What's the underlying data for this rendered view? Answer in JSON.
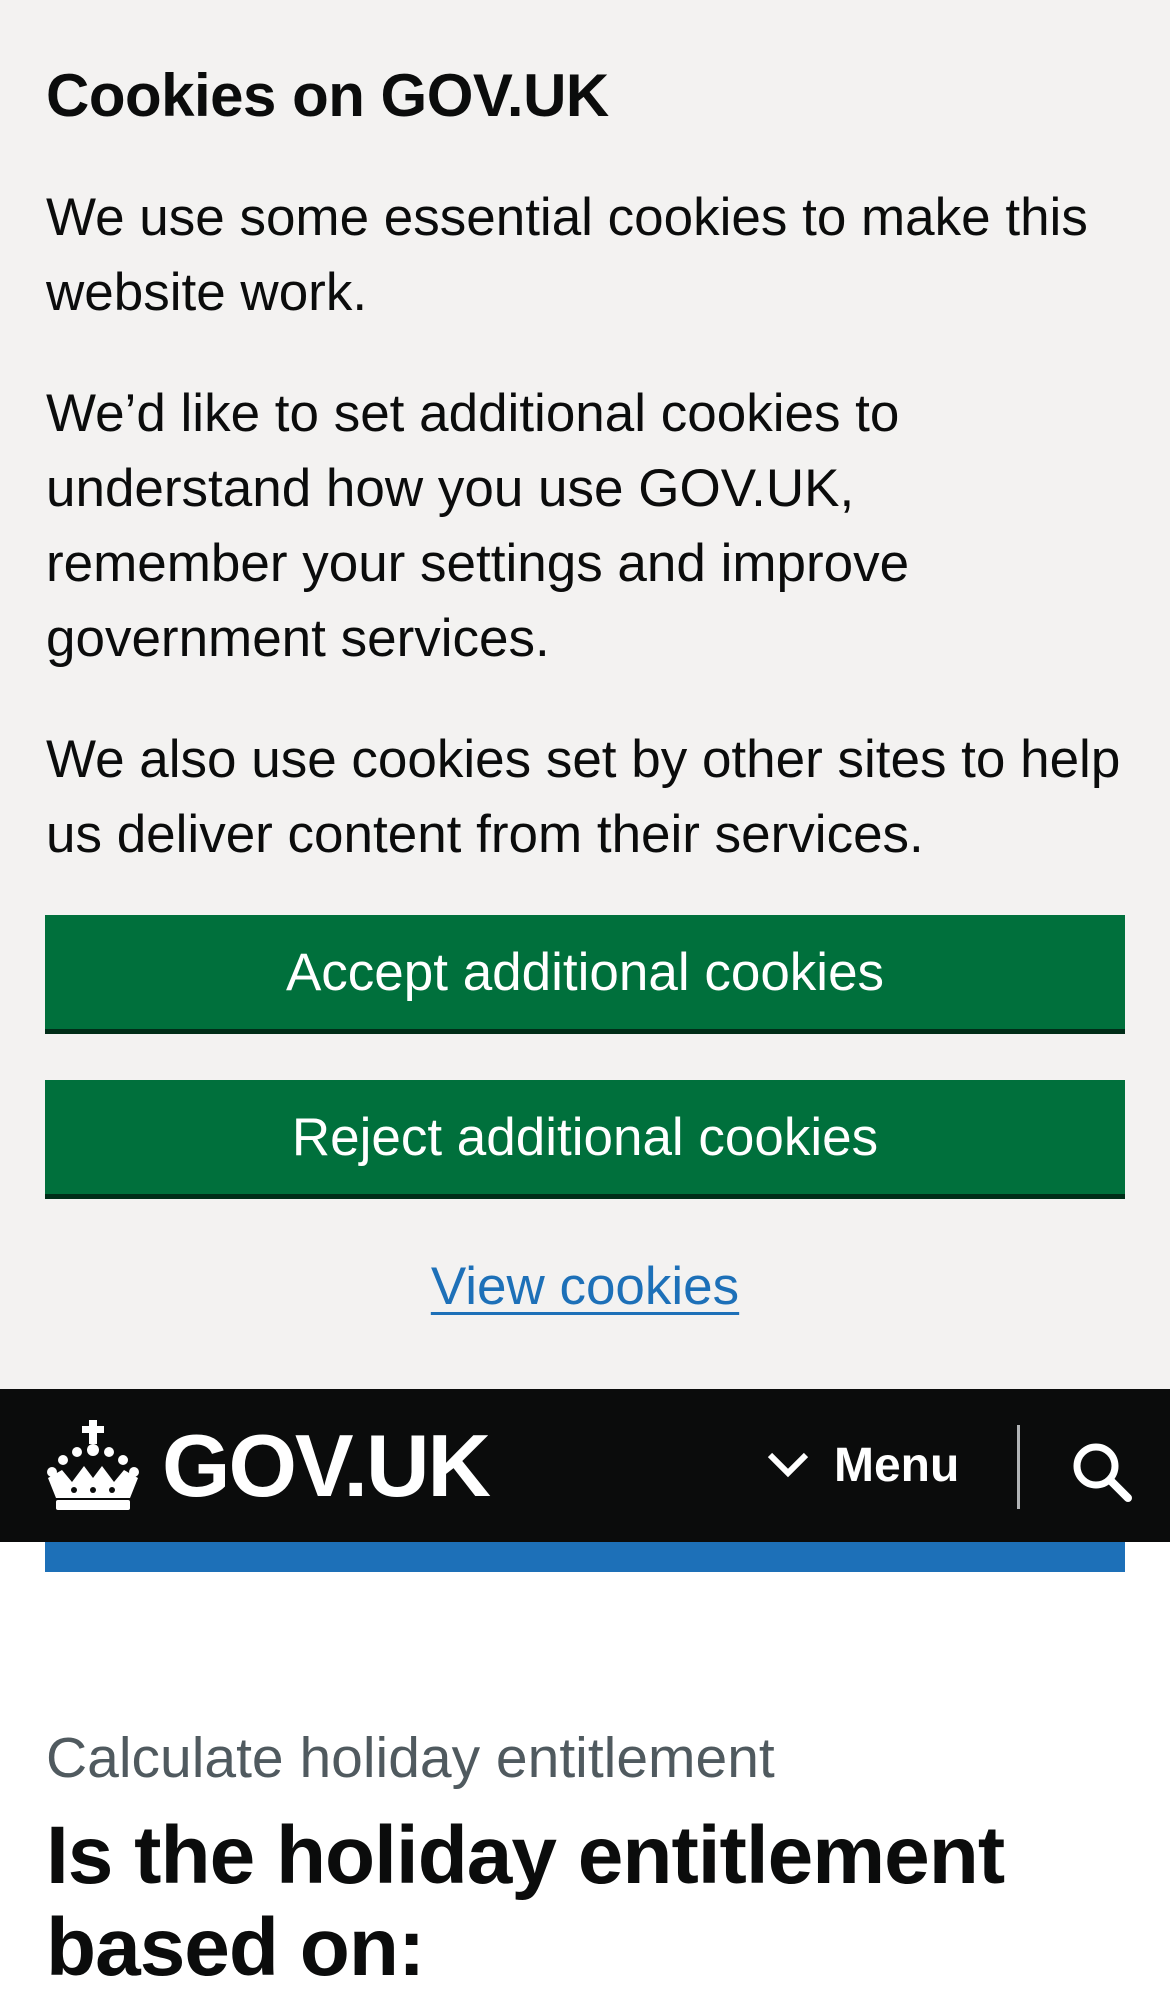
{
  "cookie_banner": {
    "title": "Cookies on GOV.UK",
    "paragraphs": [
      "We use some essential cookies to make this website work.",
      "We’d like to set additional cookies to understand how you use GOV.UK, remember your settings and improve government services.",
      "We also use cookies set by other sites to help us deliver content from their services."
    ],
    "accept_label": "Accept additional cookies",
    "reject_label": "Reject additional cookies",
    "view_cookies_label": "View cookies"
  },
  "header": {
    "logo_icon": "crown-icon",
    "logo_text": "GOV.UK",
    "menu_icon": "chevron-down-icon",
    "menu_label": "Menu",
    "search_icon": "search-icon"
  },
  "main": {
    "caption": "Calculate holiday entitlement",
    "question": "Is the holiday entitlement based on:"
  },
  "colors": {
    "banner_background": "#f3f2f1",
    "button_green": "#00703c",
    "link_blue": "#1d70b8",
    "header_black": "#0b0c0c",
    "accent_bar_blue": "#1d70b8",
    "caption_grey": "#505a5f"
  }
}
